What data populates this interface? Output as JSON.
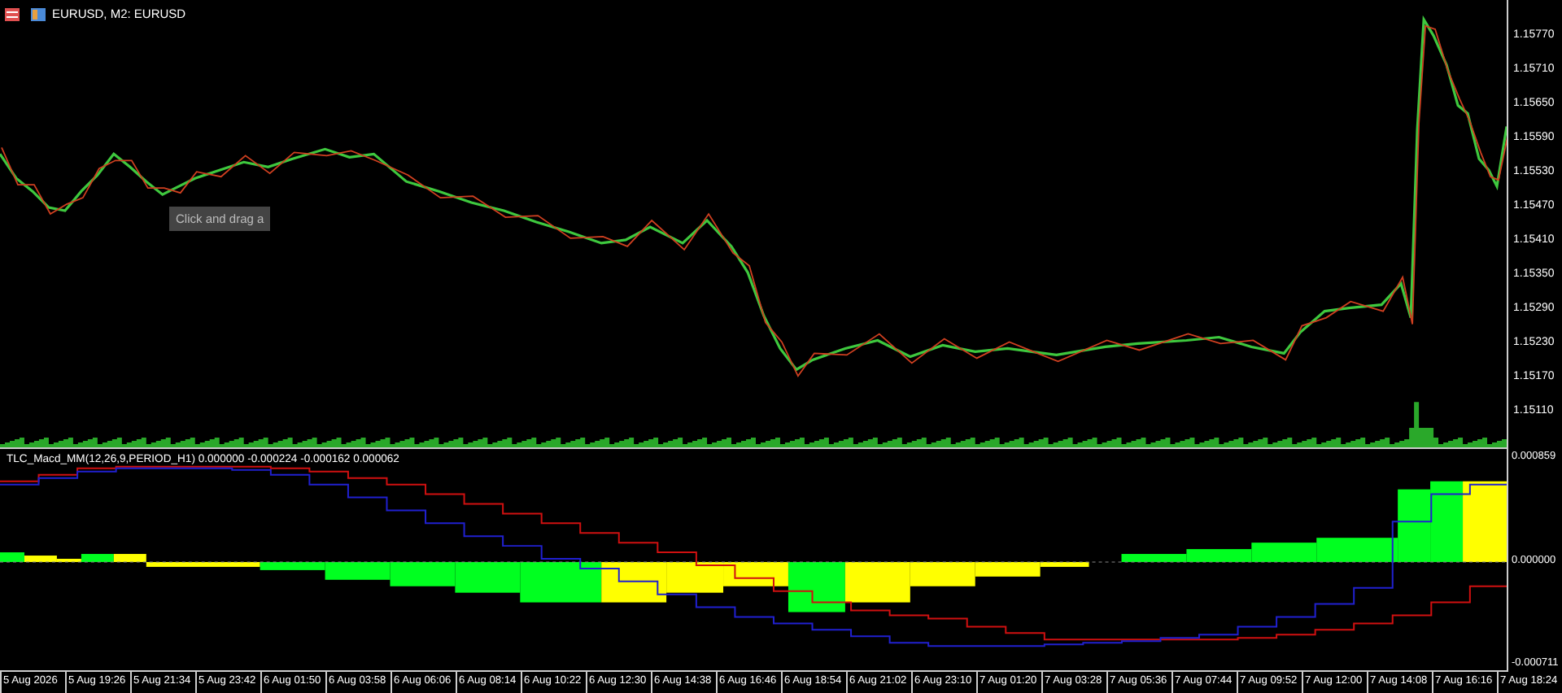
{
  "chart_title": "EURUSD, M2:  EURUSD",
  "tooltip": "Click and drag a",
  "price_axis": [
    "1.15770",
    "1.15710",
    "1.15650",
    "1.15590",
    "1.15530",
    "1.15470",
    "1.15410",
    "1.15350",
    "1.15290",
    "1.15230",
    "1.15170",
    "1.15110"
  ],
  "indicator": {
    "label": "TLC_Macd_MM(12,26,9,PERIOD_H1) 0.000000 -0.000224 -0.000162 0.000062",
    "axis": [
      "0.000859",
      "0.000000",
      "-0.000711"
    ]
  },
  "time_axis": [
    "5 Aug 2026",
    "5 Aug 19:26",
    "5 Aug 21:34",
    "5 Aug 23:42",
    "6 Aug 01:50",
    "6 Aug 03:58",
    "6 Aug 06:06",
    "6 Aug 08:14",
    "6 Aug 10:22",
    "6 Aug 12:30",
    "6 Aug 14:38",
    "6 Aug 16:46",
    "6 Aug 18:54",
    "6 Aug 21:02",
    "6 Aug 23:10",
    "7 Aug 01:20",
    "7 Aug 03:28",
    "7 Aug 05:36",
    "7 Aug 07:44",
    "7 Aug 09:52",
    "7 Aug 12:00",
    "7 Aug 14:08",
    "7 Aug 16:16",
    "7 Aug 18:24"
  ]
}
